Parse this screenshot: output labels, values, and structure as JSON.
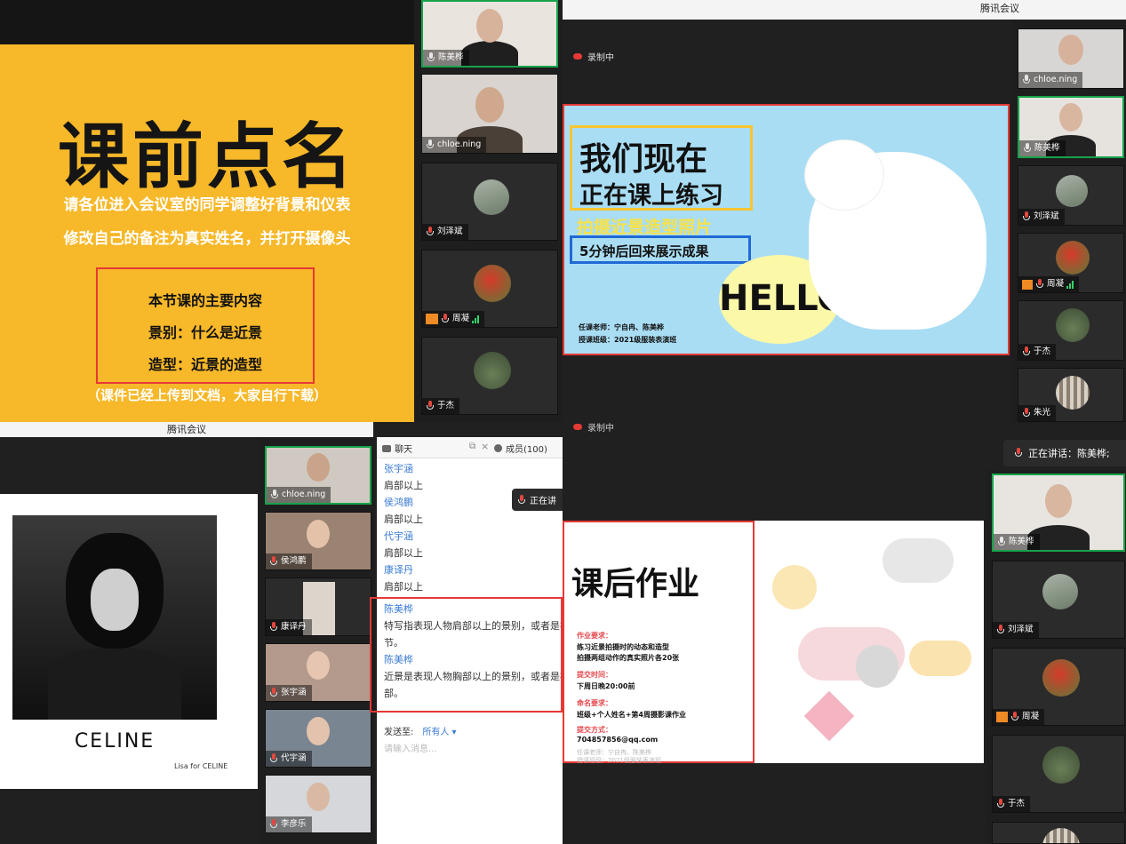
{
  "app_title": "腾讯会议",
  "q1": {
    "slide": {
      "title": "课前点名",
      "line1": "请各位进入会议室的同学调整好背景和仪表",
      "line2": "修改自己的备注为真实姓名，并打开摄像头",
      "box1": "本节课的主要内容",
      "box2": "景别：什么是近景",
      "box3": "造型：近景的造型",
      "note": "（课件已经上传到文档，大家自行下载）"
    },
    "participants": [
      "陈美桦",
      "chloe.ning",
      "刘泽斌",
      "周凝",
      "于杰"
    ]
  },
  "q2": {
    "recording": "录制中",
    "slide": {
      "title1": "我们现在",
      "title2": "正在课上练习",
      "sub1": "拍摄近景造型照片",
      "sub2": "5分钟后回来展示成果",
      "bubble": "HELLO",
      "teacher": "任课老师：宁自冉、陈美桦",
      "class": "授课班级：2021级服装表演班"
    },
    "participants": [
      "chloe.ning",
      "陈美桦",
      "刘泽斌",
      "周凝",
      "于杰",
      "朱光"
    ]
  },
  "q3": {
    "slide": {
      "brand": "CELINE",
      "caption": "Lisa for CELINE"
    },
    "participants": [
      "chloe.ning",
      "侯鸿鹏",
      "康译丹",
      "张宇涵",
      "代宇涵",
      "李彦乐"
    ],
    "chat": {
      "tab_chat": "聊天",
      "tab_members": "成员(100)",
      "messages": [
        {
          "name": "张宇涵",
          "text": "肩部以上"
        },
        {
          "name": "侯鸿鹏",
          "text": "肩部以上"
        },
        {
          "name": "代宇涵",
          "text": "肩部以上"
        },
        {
          "name": "康译丹",
          "text": "肩部以上"
        }
      ],
      "hl1_name": "陈美桦",
      "hl1_a": "特写指表现人物肩部以上的景别，或者是被",
      "hl1_b": "节。",
      "hl2_name": "陈美桦",
      "hl2_a": "近景是表现人物胸部以上的景别，或者是被",
      "hl2_b": "部。",
      "send_to": "发送至:",
      "send_target": "所有人",
      "placeholder": "请输入消息..."
    },
    "speaking": "正在讲"
  },
  "q4": {
    "recording": "录制中",
    "speaking": "正在讲话：陈美桦;",
    "slide": {
      "title": "课后作业",
      "req_h": "作业要求：",
      "req_1": "练习近景拍摄时的动态和造型",
      "req_2": "拍摄两组动作的真实照片各20张",
      "due_h": "提交时间：",
      "due": "下周日晚20:00前",
      "name_h": "命名要求：",
      "name": "班级+个人姓名+第4周摄影课作业",
      "submit_h": "提交方式：",
      "email": "704857856@qq.com",
      "teacher": "任课老师：宁自冉、陈美桦",
      "class": "授课班级：2021级服装表演班"
    },
    "participants": [
      "陈美桦",
      "刘泽斌",
      "周凝",
      "于杰"
    ]
  },
  "colors": {
    "slide_yellow": "#f7b829",
    "active_border": "#16a34a",
    "highlight_red": "#e53935",
    "link_blue": "#3a7bd5"
  }
}
